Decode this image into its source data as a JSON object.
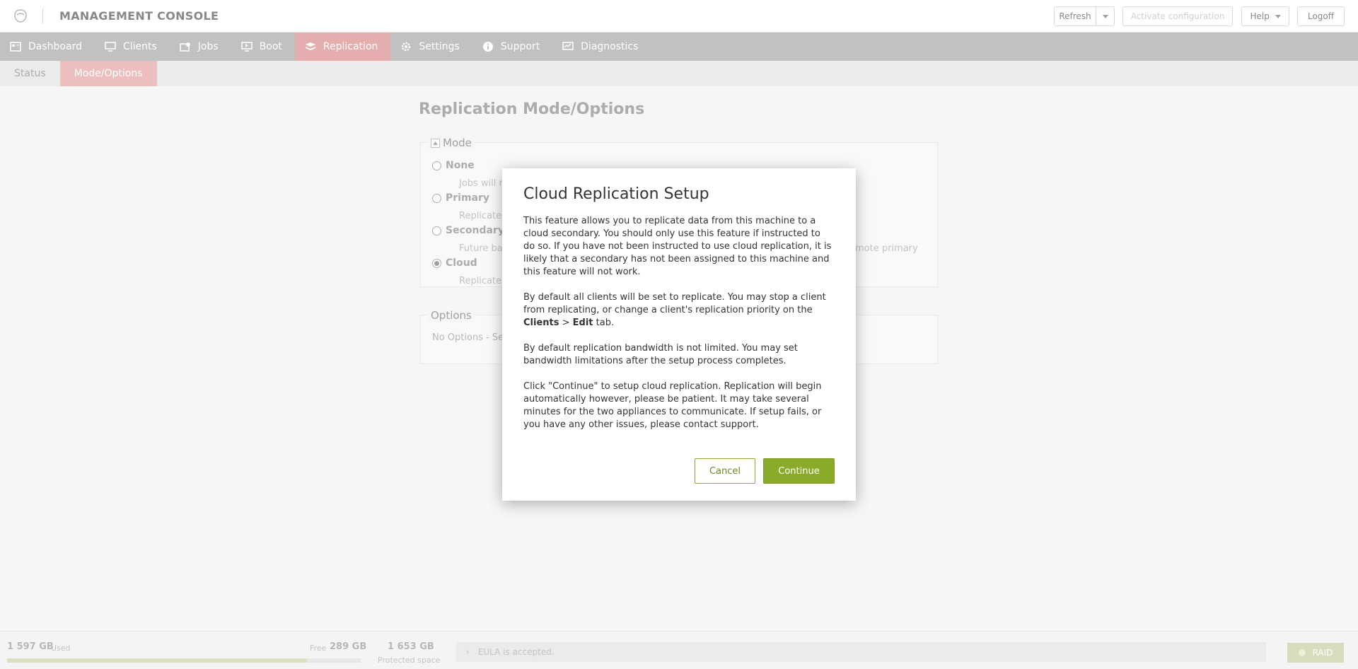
{
  "header": {
    "title": "MANAGEMENT CONSOLE",
    "refresh_label": "Refresh",
    "activate_label": "Activate configuration",
    "help_label": "Help",
    "logoff_label": "Logoff"
  },
  "nav": {
    "items": [
      {
        "label": "Dashboard",
        "icon": "dashboard-icon"
      },
      {
        "label": "Clients",
        "icon": "monitor-icon"
      },
      {
        "label": "Jobs",
        "icon": "jobs-icon"
      },
      {
        "label": "Boot",
        "icon": "boot-icon"
      },
      {
        "label": "Replication",
        "icon": "replication-icon",
        "active": true
      },
      {
        "label": "Settings",
        "icon": "gear-icon"
      },
      {
        "label": "Support",
        "icon": "info-icon"
      },
      {
        "label": "Diagnostics",
        "icon": "diagnostics-icon"
      }
    ]
  },
  "subnav": {
    "items": [
      {
        "label": "Status"
      },
      {
        "label": "Mode/Options",
        "active": true
      }
    ]
  },
  "page": {
    "title": "Replication Mode/Options",
    "mode_legend": "Mode",
    "modes": [
      {
        "label": "None",
        "desc": "Jobs will n"
      },
      {
        "label": "Primary",
        "desc": "Replicate b"
      },
      {
        "label": "Secondary",
        "desc": "Future bac",
        "desc_right": "mote primary"
      },
      {
        "label": "Cloud",
        "desc": "Replicate b",
        "selected": true
      }
    ],
    "options_legend": "Options",
    "options_text": "No Options - Sele"
  },
  "modal": {
    "title": "Cloud Replication Setup",
    "p1": "This feature allows you to replicate data from this machine to a cloud secondary. You should only use this feature if instructed to do so. If you have not been instructed to use cloud replication, it is likely that a secondary has not been assigned to this machine and this feature will not work.",
    "p2_a": "By default all clients will be set to replicate. You may stop a client from replicating, or change a client's replication priority on the ",
    "p2_clients": "Clients",
    "p2_sep": " > ",
    "p2_edit": "Edit",
    "p2_b": " tab.",
    "p3": "By default replication bandwidth is not limited. You may set bandwidth limitations after the setup process completes.",
    "p4": "Click \"Continue\" to setup cloud replication. Replication will begin automatically however, please be patient. It may take several minutes for the two appliances to communicate. If setup fails, or you have any other issues, please contact support.",
    "cancel_label": "Cancel",
    "continue_label": "Continue"
  },
  "footer": {
    "used_value": "1 597 GB",
    "used_label": "Used",
    "free_label": "Free",
    "free_value": "289 GB",
    "usage_fraction": 0.847,
    "protected_value": "1 653 GB",
    "protected_label": "Protected space",
    "eula_text": "EULA is accepted.",
    "raid_label": "RAID"
  }
}
